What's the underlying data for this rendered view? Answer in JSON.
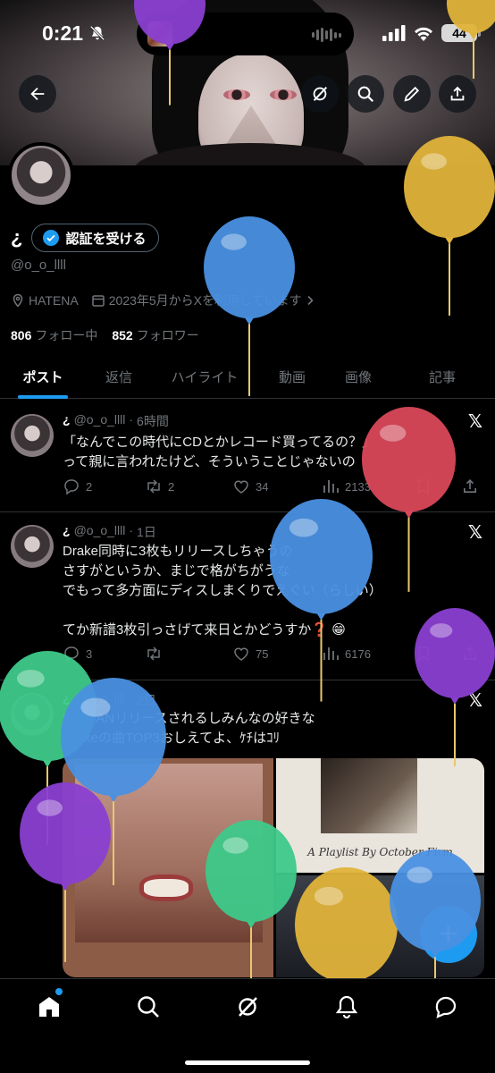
{
  "status_bar": {
    "time": "0:21",
    "battery": "44"
  },
  "profile": {
    "name": "¿",
    "verify_label": "認証を受ける",
    "handle": "@o_o_llll",
    "location": "HATENA",
    "joined": "2023年5月からXを利用しています",
    "following_count": "806",
    "following_label": "フォロー中",
    "followers_count": "852",
    "followers_label": "フォロワー"
  },
  "tabs": [
    "ポスト",
    "返信",
    "ハイライト",
    "動画",
    "画像",
    "記事"
  ],
  "posts": [
    {
      "name": "¿",
      "handle": "@o_o_llll",
      "time": "6時間",
      "text": "「なんでこの時代にCDとかレコード買ってるの？」\nって親に言われたけど、そういうことじゃないの",
      "replies": "2",
      "reposts": "2",
      "likes": "34",
      "views": "2133"
    },
    {
      "name": "¿",
      "handle": "@o_o_llll",
      "time": "1日",
      "text": "Drake同時に3枚もリリースしちゃうの\nさすがというか、まじで格がちがうな\nでもって多方面にディスしまくりでえぐい（らしい）\n\nてか新譜3枚引っさげて来日とかどうすか❓ 😁",
      "replies": "3",
      "reposts": "",
      "likes": "75",
      "views": "6176"
    },
    {
      "name": "¿",
      "handle": "@o_o_llll",
      "time": "2日",
      "text": "ICEMANリリースされるしみんなの好きな\nDrakeの曲TOP3おしえてよ、ｹﾁはｺﾘ",
      "media_caption": "A Playlist By October Firm"
    }
  ],
  "fab_label": "+",
  "nav": [
    "home-icon",
    "search-icon",
    "grok-icon",
    "notifications-icon",
    "messages-icon"
  ],
  "colors": {
    "accent": "#1d9bf0",
    "background": "#000000",
    "muted": "#71767b"
  }
}
